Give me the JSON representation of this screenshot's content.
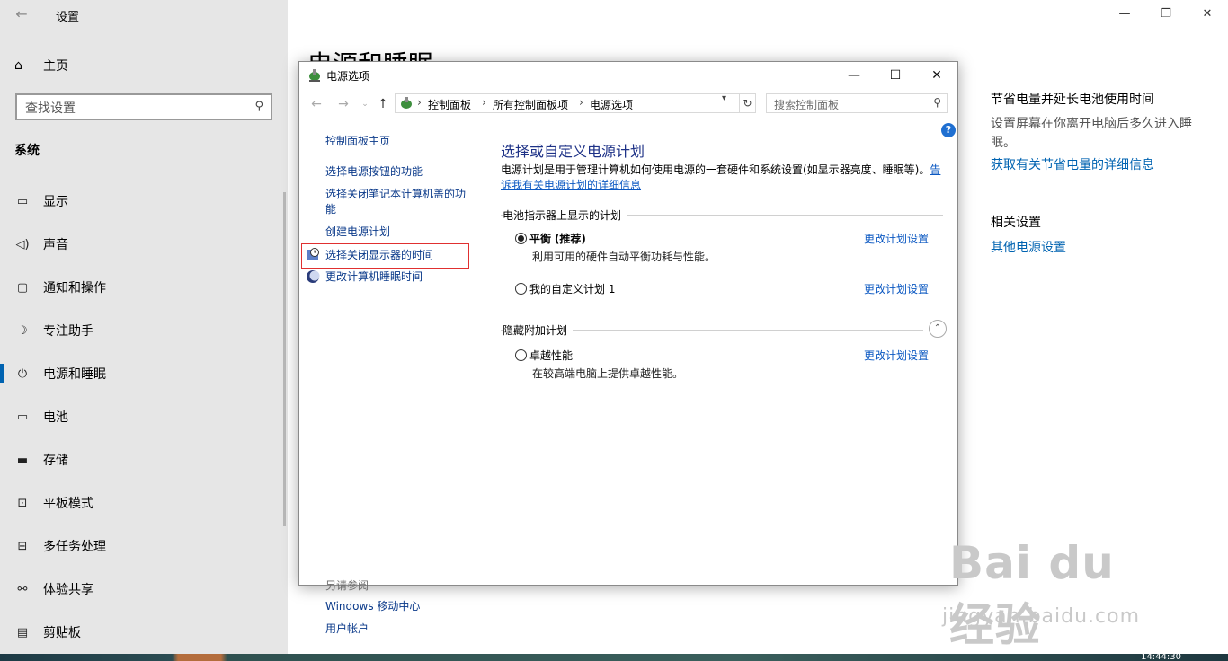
{
  "settings": {
    "title": "设置",
    "page_heading": "电源和睡眠",
    "home_label": "主页",
    "search_placeholder": "查找设置",
    "section": "系统",
    "nav": [
      {
        "label": "显示",
        "icon": "monitor-icon"
      },
      {
        "label": "声音",
        "icon": "speaker-icon"
      },
      {
        "label": "通知和操作",
        "icon": "notification-icon"
      },
      {
        "label": "专注助手",
        "icon": "moon-icon"
      },
      {
        "label": "电源和睡眠",
        "icon": "power-icon",
        "selected": true
      },
      {
        "label": "电池",
        "icon": "battery-icon"
      },
      {
        "label": "存储",
        "icon": "storage-icon"
      },
      {
        "label": "平板模式",
        "icon": "tablet-icon"
      },
      {
        "label": "多任务处理",
        "icon": "multitask-icon"
      },
      {
        "label": "体验共享",
        "icon": "share-icon"
      },
      {
        "label": "剪贴板",
        "icon": "clipboard-icon"
      }
    ],
    "aside": {
      "title": "节省电量并延长电池使用时间",
      "desc": "设置屏幕在你离开电脑后多久进入睡眠。",
      "link": "获取有关节省电量的详细信息",
      "related_title": "相关设置",
      "related_link": "其他电源设置"
    }
  },
  "dialog": {
    "title": "电源选项",
    "breadcrumbs": [
      "控制面板",
      "所有控制面板项",
      "电源选项"
    ],
    "search_placeholder": "搜索控制面板",
    "left_links": {
      "home": "控制面板主页",
      "l1": "选择电源按钮的功能",
      "l2": "选择关闭笔记本计算机盖的功能",
      "l3": "创建电源计划",
      "l4": "选择关闭显示器的时间",
      "l5": "更改计算机睡眠时间"
    },
    "see_also": {
      "title": "另请参阅",
      "items": [
        "Windows 移动中心",
        "用户帐户"
      ]
    },
    "main": {
      "title": "选择或自定义电源计划",
      "desc": "电源计划是用于管理计算机如何使用电源的一套硬件和系统设置(如显示器亮度、睡眠等)。",
      "desc_link": "告诉我有关电源计划的详细信息",
      "group1": "电池指示器上显示的计划",
      "group2": "隐藏附加计划",
      "change_label": "更改计划设置",
      "plans": [
        {
          "name": "平衡",
          "tag": "(推荐)",
          "desc": "利用可用的硬件自动平衡功耗与性能。",
          "selected": true
        },
        {
          "name": "我的自定义计划 1",
          "desc": "",
          "selected": false
        },
        {
          "name": "卓越性能",
          "desc": "在较高端电脑上提供卓越性能。",
          "selected": false
        }
      ]
    }
  },
  "watermark": {
    "big": "Bai du 经验",
    "small": "jingyan.baidu.com"
  },
  "clock": "14:44:30",
  "colors": {
    "accent": "#0063b1",
    "link": "#0b58c2",
    "highlight_border": "#e03030"
  }
}
